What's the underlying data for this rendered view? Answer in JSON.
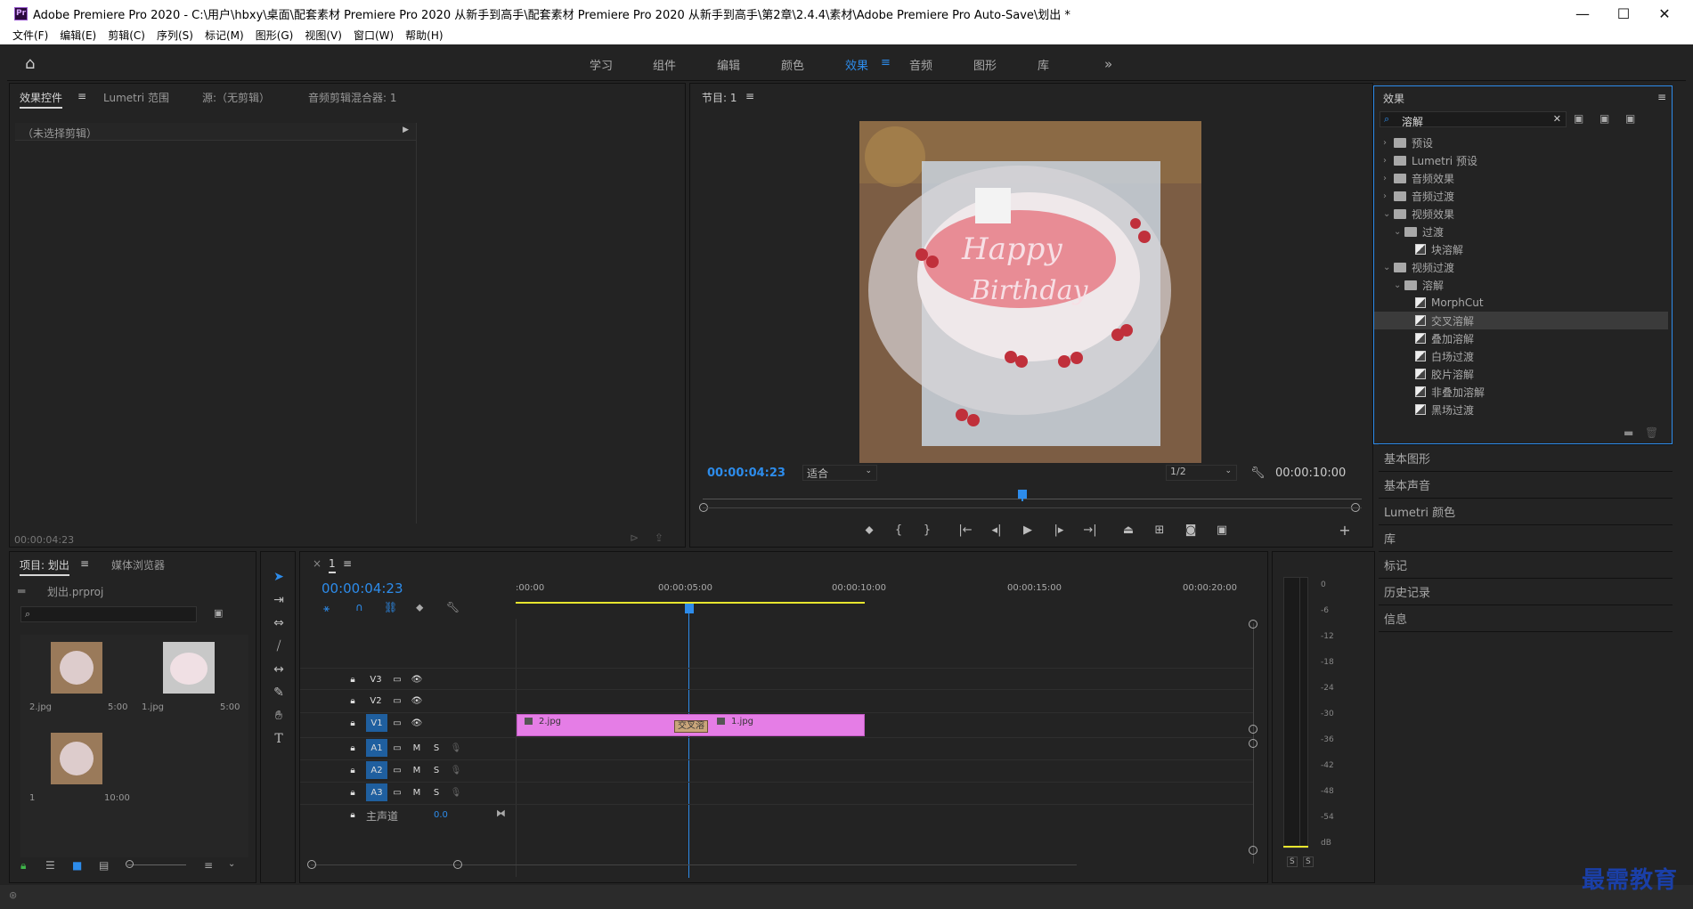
{
  "window": {
    "title": "Adobe Premiere Pro 2020 - C:\\用户\\hbxy\\桌面\\配套素材 Premiere Pro 2020 从新手到高手\\配套素材 Premiere Pro 2020 从新手到高手\\第2章\\2.4.4\\素材\\Adobe Premiere Pro Auto-Save\\划出 *",
    "app_badge": "Pr",
    "minimize": "—",
    "maximize": "☐",
    "close": "✕"
  },
  "menu": [
    "文件(F)",
    "编辑(E)",
    "剪辑(C)",
    "序列(S)",
    "标记(M)",
    "图形(G)",
    "视图(V)",
    "窗口(W)",
    "帮助(H)"
  ],
  "workspaces": {
    "tabs": [
      "学习",
      "组件",
      "编辑",
      "颜色",
      "效果",
      "音频",
      "图形",
      "库"
    ],
    "active": "效果",
    "overflow": "»"
  },
  "effect_controls": {
    "tabs": [
      "效果控件",
      "Lumetri 范围",
      "源:（无剪辑）",
      "音频剪辑混合器: 1"
    ],
    "no_clip": "（未选择剪辑）",
    "timecode": "00:00:04:23"
  },
  "program": {
    "title": "节目: 1",
    "timecode": "00:00:04:23",
    "fit": "适合",
    "resolution": "1/2",
    "duration": "00:00:10:00"
  },
  "effects": {
    "title": "效果",
    "search": "溶解",
    "tree": [
      {
        "label": "预设",
        "level": 0,
        "type": "bin",
        "chev": "›"
      },
      {
        "label": "Lumetri 预设",
        "level": 0,
        "type": "bin",
        "chev": "›"
      },
      {
        "label": "音频效果",
        "level": 0,
        "type": "folder",
        "chev": "›"
      },
      {
        "label": "音频过渡",
        "level": 0,
        "type": "folder",
        "chev": "›"
      },
      {
        "label": "视频效果",
        "level": 0,
        "type": "folder",
        "chev": "⌄"
      },
      {
        "label": "过渡",
        "level": 1,
        "type": "folder",
        "chev": "⌄"
      },
      {
        "label": "块溶解",
        "level": 2,
        "type": "fx",
        "chev": ""
      },
      {
        "label": "视频过渡",
        "level": 0,
        "type": "folder",
        "chev": "⌄"
      },
      {
        "label": "溶解",
        "level": 1,
        "type": "folder",
        "chev": "⌄"
      },
      {
        "label": "MorphCut",
        "level": 2,
        "type": "fx",
        "chev": ""
      },
      {
        "label": "交叉溶解",
        "level": 2,
        "type": "fx",
        "chev": "",
        "selected": true
      },
      {
        "label": "叠加溶解",
        "level": 2,
        "type": "fx",
        "chev": ""
      },
      {
        "label": "白场过渡",
        "level": 2,
        "type": "fx",
        "chev": ""
      },
      {
        "label": "胶片溶解",
        "level": 2,
        "type": "fx",
        "chev": ""
      },
      {
        "label": "非叠加溶解",
        "level": 2,
        "type": "fx",
        "chev": ""
      },
      {
        "label": "黑场过渡",
        "level": 2,
        "type": "fx",
        "chev": ""
      }
    ]
  },
  "side_panels": [
    "基本图形",
    "基本声音",
    "Lumetri 颜色",
    "库",
    "标记",
    "历史记录",
    "信息"
  ],
  "project": {
    "tabs": [
      "项目: 划出",
      "媒体浏览器"
    ],
    "file": "划出.prproj",
    "items": [
      {
        "name": "2.jpg",
        "dur": "5:00"
      },
      {
        "name": "1.jpg",
        "dur": "5:00"
      },
      {
        "name": "1",
        "dur": "10:00"
      }
    ]
  },
  "timeline": {
    "seq": "1",
    "timecode": "00:00:04:23",
    "ruler": [
      ":00:00",
      "00:00:05:00",
      "00:00:10:00",
      "00:00:15:00",
      "00:00:20:00"
    ],
    "tracks": {
      "video": [
        "V3",
        "V2",
        "V1"
      ],
      "audio": [
        "A1",
        "A2",
        "A3"
      ],
      "master": "主声道",
      "master_val": "0.0",
      "m": "M",
      "s": "S"
    },
    "clips": [
      {
        "name": "2.jpg"
      },
      {
        "name": "1.jpg"
      }
    ],
    "transition": "交叉溶"
  },
  "meter": {
    "labels": [
      "0",
      "-6",
      "-12",
      "-18",
      "-24",
      "-30",
      "-36",
      "-42",
      "-48",
      "-54",
      "dB"
    ],
    "solo": [
      "S",
      "S"
    ]
  },
  "watermark": "最需教育"
}
